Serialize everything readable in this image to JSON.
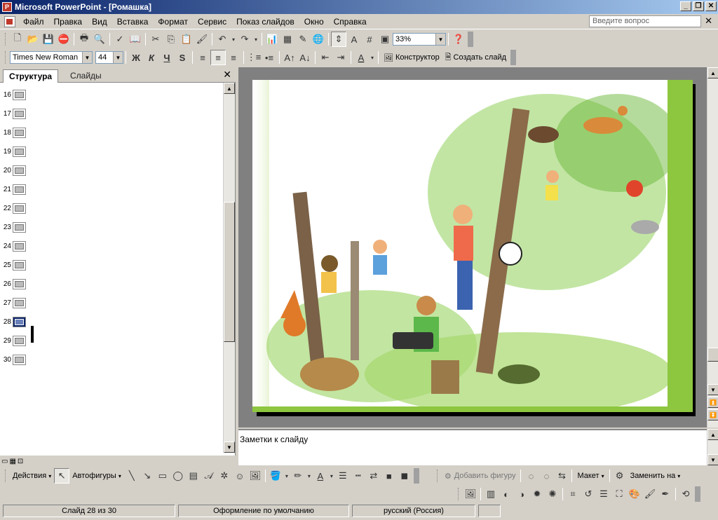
{
  "window": {
    "title": "Microsoft PowerPoint - [Ромашка]"
  },
  "menu": [
    "Файл",
    "Правка",
    "Вид",
    "Вставка",
    "Формат",
    "Сервис",
    "Показ слайдов",
    "Окно",
    "Справка"
  ],
  "help_placeholder": "Введите вопрос",
  "standard_toolbar": {
    "zoom": "33%"
  },
  "format_toolbar": {
    "font": "Times New Roman",
    "size": "44",
    "bold": "Ж",
    "italic": "К",
    "underline": "Ч",
    "shadow": "S",
    "designer": "Конструктор",
    "new_slide": "Создать слайд"
  },
  "left_pane": {
    "tab_outline": "Структура",
    "tab_slides": "Слайды",
    "slides": [
      "16",
      "17",
      "18",
      "19",
      "20",
      "21",
      "22",
      "23",
      "24",
      "25",
      "26",
      "27",
      "28",
      "29",
      "30"
    ],
    "selected": "28"
  },
  "notes_placeholder": "Заметки к слайду",
  "drawing_toolbar": {
    "actions": "Действия",
    "autoshapes": "Автофигуры"
  },
  "org_toolbar": {
    "add_shape": "Добавить фигуру",
    "layout": "Макет",
    "replace": "Заменить на"
  },
  "status": {
    "slide": "Слайд 28 из 30",
    "design": "Оформление по умолчанию",
    "language": "русский (Россия)"
  },
  "colors": {
    "title_start": "#0a246a",
    "slide_green": "#8dc63f"
  },
  "icons": [
    "new-icon",
    "open-icon",
    "save-icon",
    "permission-icon",
    "print-icon",
    "print-preview-icon",
    "spell-icon",
    "research-icon",
    "cut-icon",
    "copy-icon",
    "paste-icon",
    "format-painter-icon",
    "undo-icon",
    "redo-icon",
    "chart-icon",
    "table-icon",
    "tables-borders-icon",
    "hyperlink-icon",
    "expand-icon",
    "grayscale-icon",
    "grid-icon",
    "color-icon",
    "help-icon"
  ]
}
